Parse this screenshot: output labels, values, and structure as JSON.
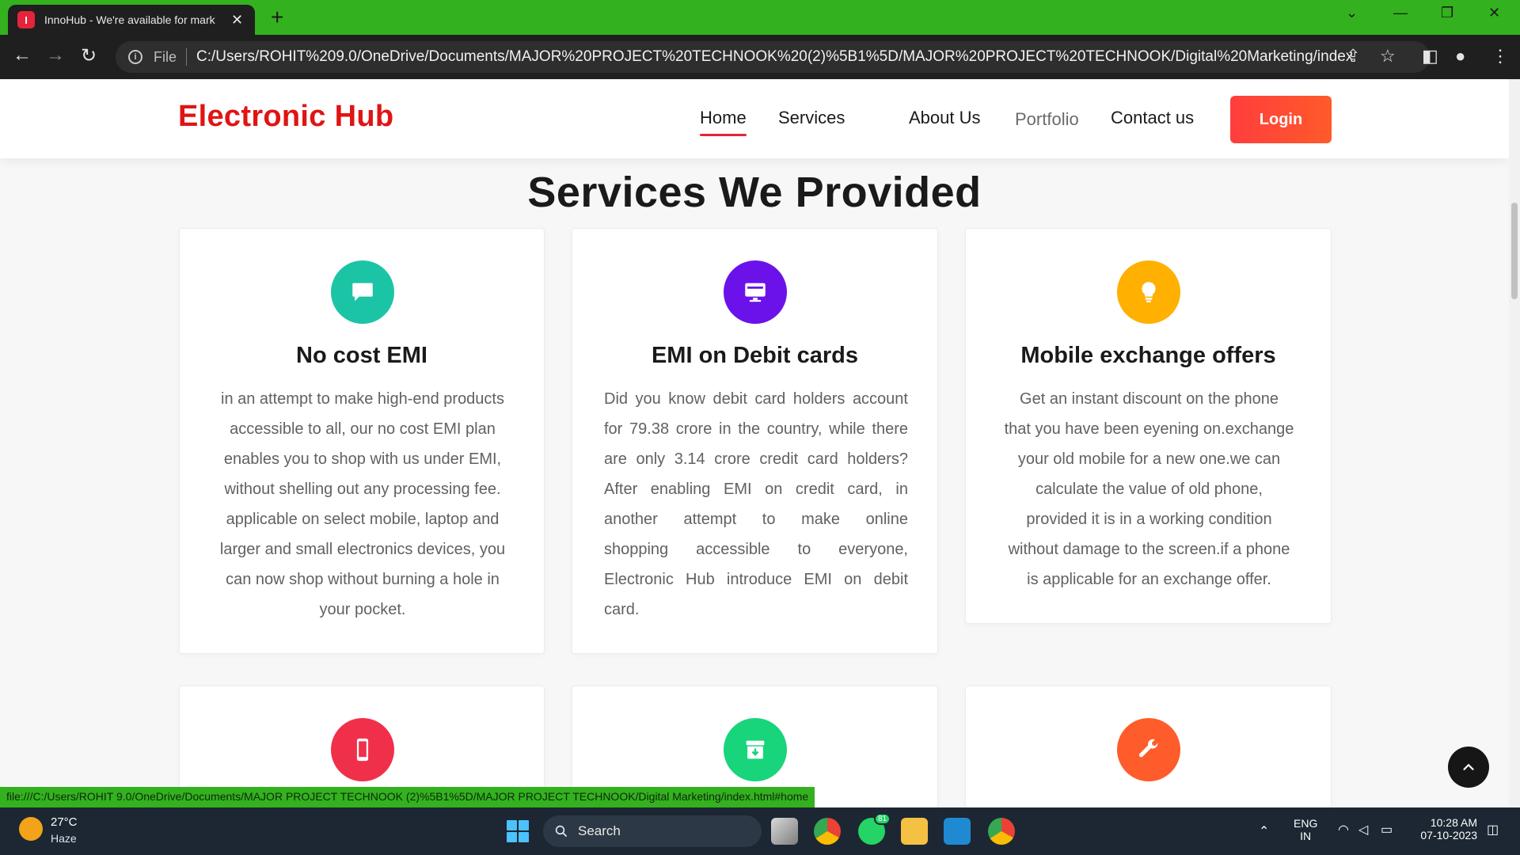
{
  "browser": {
    "tab_title": "InnoHub - We're available for mark",
    "tab_favicon_letter": "I",
    "new_tab_label": "+",
    "omnibox_scheme_label": "File",
    "url": "C:/Users/ROHIT%209.0/OneDrive/Documents/MAJOR%20PROJECT%20TECHNOOK%20(2)%5B1%5D/MAJOR%20PROJECT%20TECHNOOK/Digital%20Marketing/index.html#home",
    "status_url": "file:///C:/Users/ROHIT 9.0/OneDrive/Documents/MAJOR PROJECT TECHNOOK (2)%5B1%5D/MAJOR PROJECT TECHNOOK/Digital Marketing/index.html#home"
  },
  "header": {
    "brand": "Electronic Hub",
    "nav": [
      {
        "label": "Home",
        "active": true
      },
      {
        "label": "Services"
      },
      {
        "label": "About Us"
      },
      {
        "label": "Portfolio"
      },
      {
        "label": "Contact us"
      }
    ],
    "login_label": "Login"
  },
  "services": {
    "title": "Services We Provided",
    "cards": [
      {
        "title": "No cost EMI",
        "icon": "chat-bubble-icon",
        "color": "#1cc4a6",
        "lines": [
          "in an attempt to make high-end products",
          "accessible to all, our no cost EMI plan",
          "enables you to shop with us under EMI,",
          "without shelling out any processing fee.",
          "applicable on select mobile, laptop and",
          "larger and small electronics devices, you",
          "can now shop without burning a hole in",
          "your pocket."
        ]
      },
      {
        "title": "EMI on Debit cards",
        "icon": "monitor-icon",
        "color": "#6b12ea",
        "lines": [
          "Did you know debit card holders account",
          "for 79.38 crore in the country, while there",
          "are only 3.14 crore credit card holders?",
          "After enabling EMI on credit card, in",
          "another attempt to make online",
          "shopping accessible to everyone,",
          "Electronic Hub introduce EMI on debit",
          "card."
        ]
      },
      {
        "title": "Mobile exchange offers",
        "icon": "lightbulb-icon",
        "color": "#ffb000",
        "lines": [
          "Get an instant discount on the phone",
          "that you have been eyening on.exchange",
          "your old mobile for a new one.we can",
          "calculate the value of old phone,",
          "provided it is in a working condition",
          "without damage to the screen.if a phone",
          "is applicable for an exchange offer."
        ]
      }
    ],
    "partial_cards": [
      {
        "icon": "mobile-phone-icon",
        "color": "#f0304a"
      },
      {
        "icon": "archive-download-icon",
        "color": "#18d47b"
      },
      {
        "icon": "wrench-icon",
        "color": "#ff5c2b"
      }
    ]
  },
  "taskbar": {
    "weather_temp": "27°C",
    "weather_desc": "Haze",
    "search_label": "Search",
    "whatsapp_badge": "81",
    "lang_top": "ENG",
    "lang_bottom": "IN",
    "time": "10:28 AM",
    "date": "07-10-2023"
  }
}
